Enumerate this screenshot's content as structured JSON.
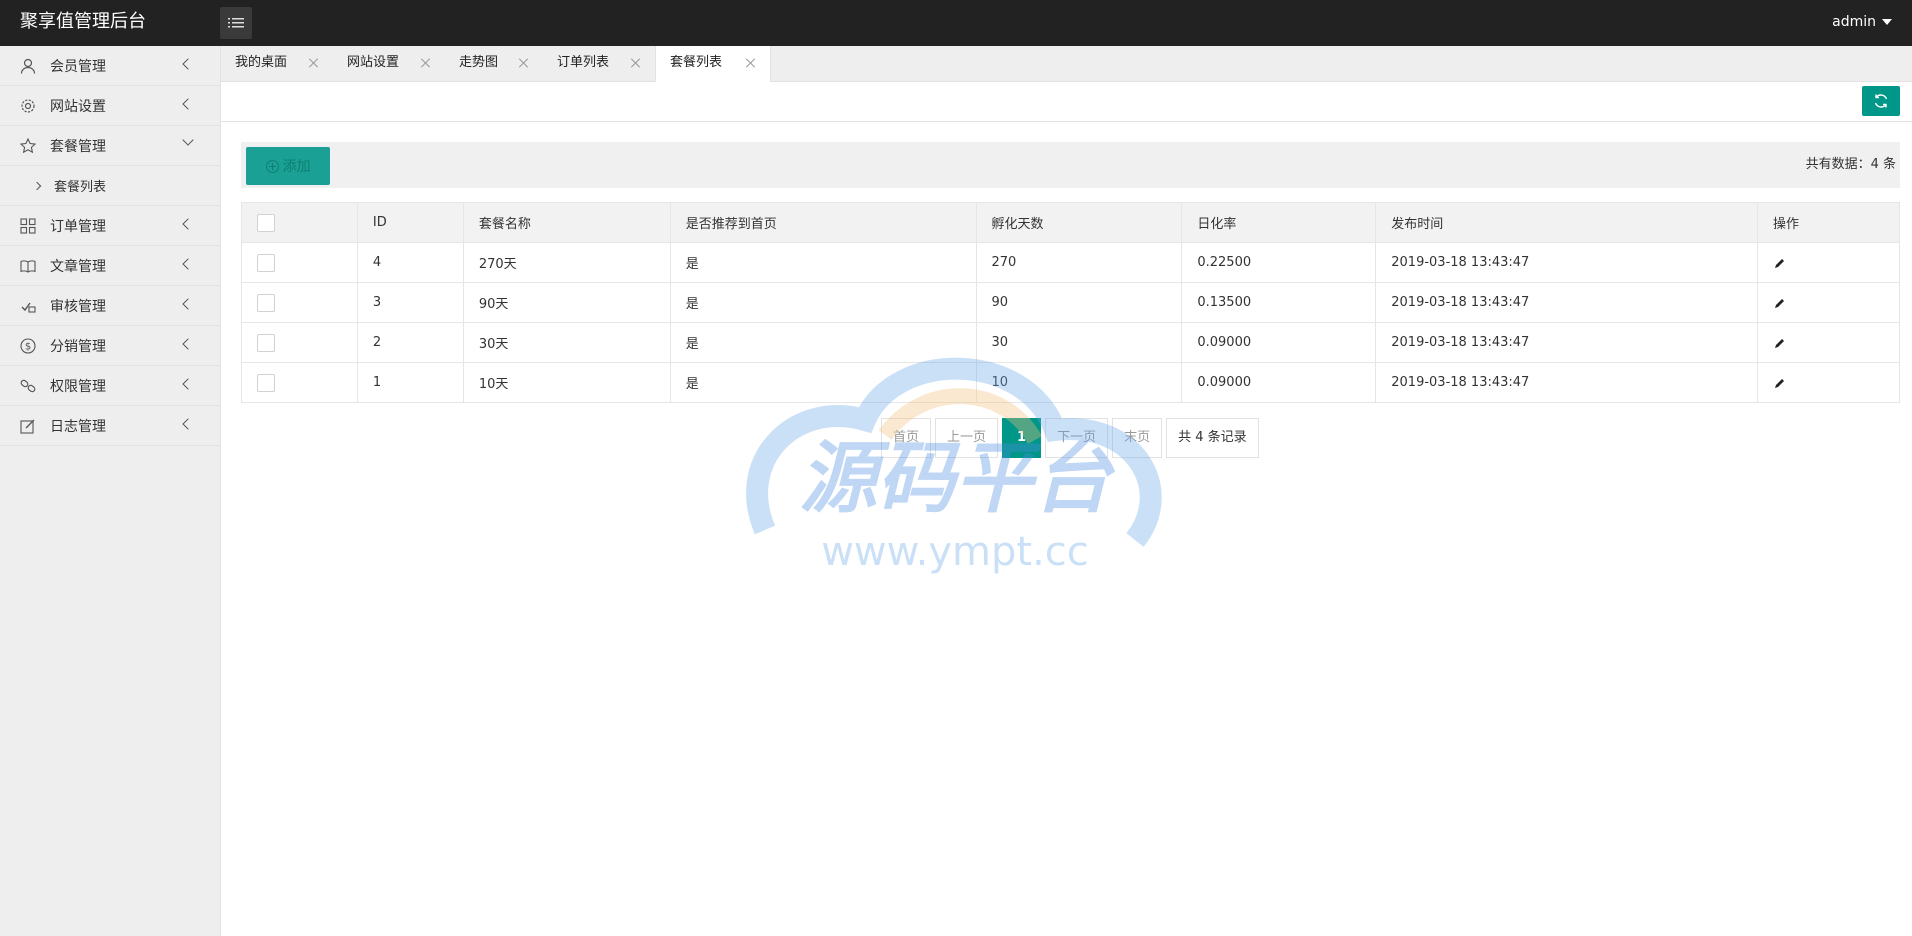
{
  "header": {
    "app_title": "聚享值管理后台",
    "menu_toggle_icon": "hamburger-icon",
    "user_name": "admin"
  },
  "sidebar": {
    "items": [
      {
        "label": "会员管理",
        "icon": "user-icon"
      },
      {
        "label": "网站设置",
        "icon": "gear-icon"
      },
      {
        "label": "套餐管理",
        "icon": "star-icon",
        "open": true,
        "children": [
          {
            "label": "套餐列表"
          }
        ]
      },
      {
        "label": "订单管理",
        "icon": "grid-icon"
      },
      {
        "label": "文章管理",
        "icon": "book-icon"
      },
      {
        "label": "审核管理",
        "icon": "audit-icon"
      },
      {
        "label": "分销管理",
        "icon": "dollar-icon"
      },
      {
        "label": "权限管理",
        "icon": "link-icon"
      },
      {
        "label": "日志管理",
        "icon": "edit-icon"
      }
    ]
  },
  "tabs": [
    {
      "label": "我的桌面"
    },
    {
      "label": "网站设置"
    },
    {
      "label": "走势图"
    },
    {
      "label": "订单列表"
    },
    {
      "label": "套餐列表",
      "active": true
    }
  ],
  "toolbar": {
    "refresh_icon": "refresh-icon",
    "add_label": "添加",
    "count_text": "共有数据：4 条"
  },
  "table": {
    "columns": [
      "",
      "ID",
      "套餐名称",
      "是否推荐到首页",
      "孵化天数",
      "日化率",
      "发布时间",
      "操作"
    ],
    "rows": [
      {
        "id": "4",
        "name": "270天",
        "recommend": "是",
        "days": "270",
        "rate": "0.22500",
        "time": "2019-03-18 13:43:47"
      },
      {
        "id": "3",
        "name": "90天",
        "recommend": "是",
        "days": "90",
        "rate": "0.13500",
        "time": "2019-03-18 13:43:47"
      },
      {
        "id": "2",
        "name": "30天",
        "recommend": "是",
        "days": "30",
        "rate": "0.09000",
        "time": "2019-03-18 13:43:47"
      },
      {
        "id": "1",
        "name": "10天",
        "recommend": "是",
        "days": "10",
        "rate": "0.09000",
        "time": "2019-03-18 13:43:47"
      }
    ]
  },
  "pagination": {
    "first": "首页",
    "prev": "上一页",
    "current": "1",
    "next": "下一页",
    "last": "末页",
    "total": "共 4 条记录"
  },
  "watermark": {
    "title": "源码平台",
    "url": "www.ympt.cc"
  },
  "colors": {
    "header_bg": "#222222",
    "accent": "#009688"
  }
}
